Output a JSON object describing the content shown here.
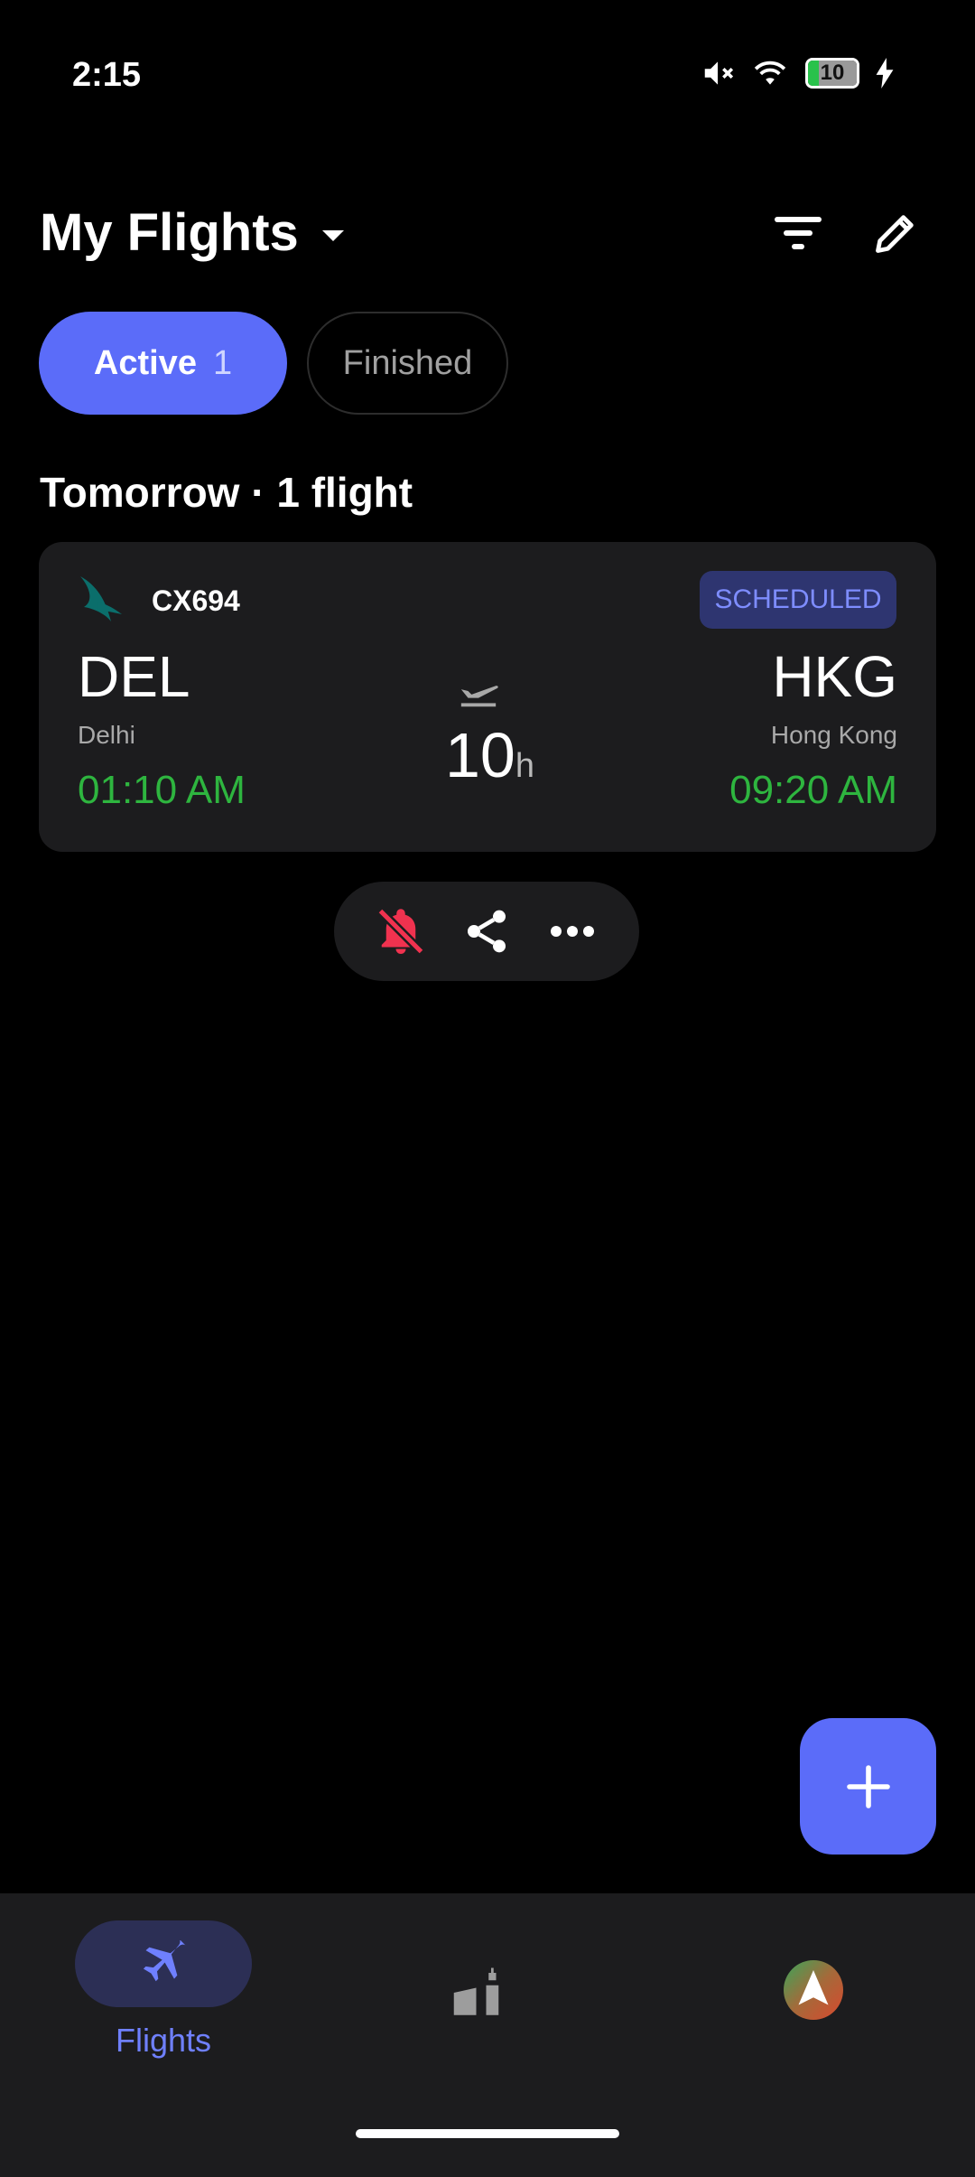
{
  "status_bar": {
    "time": "2:15",
    "battery": "10"
  },
  "header": {
    "title": "My Flights"
  },
  "tabs": [
    {
      "label": "Active",
      "count": "1"
    },
    {
      "label": "Finished"
    }
  ],
  "section": {
    "heading": "Tomorrow · 1 flight"
  },
  "flight": {
    "number": "CX694",
    "status": "SCHEDULED",
    "origin": {
      "code": "DEL",
      "city": "Delhi",
      "time": "01:10 AM"
    },
    "destination": {
      "code": "HKG",
      "city": "Hong Kong",
      "time": "09:20 AM"
    },
    "duration": "10",
    "duration_unit": "h"
  },
  "bottom_nav": {
    "flights_label": "Flights"
  },
  "colors": {
    "accent": "#5b6cf9",
    "time_green": "#2eb53f",
    "alert_red": "#f0324f",
    "card_bg": "#1c1c1e"
  },
  "icons": [
    "mute-icon",
    "wifi-icon",
    "battery-icon",
    "charging-icon",
    "filter-icon",
    "edit-icon",
    "airline-logo",
    "takeoff-icon",
    "alerts-off-icon",
    "share-icon",
    "more-icon",
    "add-icon",
    "airplane-icon",
    "airport-icon",
    "navigation-icon"
  ]
}
